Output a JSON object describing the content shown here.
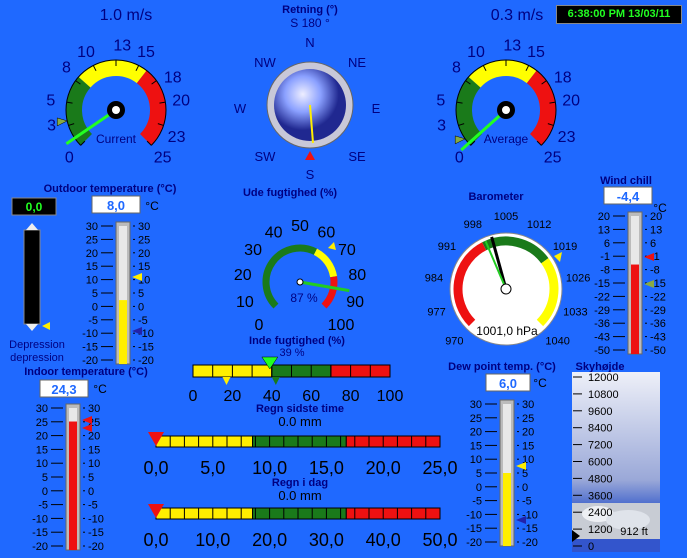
{
  "clock": "6:38:00 PM 13/03/11",
  "wind_current": {
    "speed": "1.0 m/s",
    "label": "Current",
    "ticks": [
      "0",
      "3",
      "5",
      "8",
      "10",
      "13",
      "15",
      "18",
      "20",
      "23",
      "25"
    ],
    "value": 1.0,
    "max": 25,
    "colors": {
      "low": "#1a7a1a",
      "mid": "#ffff00",
      "high": "#ee1111"
    }
  },
  "wind_average": {
    "speed": "0.3 m/s",
    "label": "Average",
    "ticks": [
      "0",
      "3",
      "5",
      "8",
      "10",
      "13",
      "15",
      "18",
      "20",
      "23",
      "25"
    ],
    "value": 0.3,
    "max": 25
  },
  "direction": {
    "title": "Retning (°)",
    "value": "S  180 °",
    "points": [
      "N",
      "NE",
      "E",
      "SE",
      "S",
      "SW",
      "W",
      "NW"
    ]
  },
  "outdoor": {
    "title": "Outdoor temperature (°C)",
    "value": "8,0",
    "unit": "°C",
    "ticks": [
      "30",
      "25",
      "20",
      "15",
      "10",
      "5",
      "0",
      "-5",
      "-10",
      "-15",
      "-20"
    ],
    "depression_value": "0,0",
    "depression_label": [
      "Depression",
      "depression"
    ]
  },
  "humidity_out": {
    "title": "Ude fugtighed (%)",
    "value": "87 %",
    "ticks": [
      "0",
      "10",
      "20",
      "30",
      "40",
      "50",
      "60",
      "70",
      "80",
      "90",
      "100"
    ]
  },
  "humidity_in": {
    "title": "Inde fugtighed (%)",
    "value": "39 %",
    "ticks": [
      "0",
      "20",
      "40",
      "60",
      "80",
      "100"
    ]
  },
  "barometer": {
    "title": "Barometer",
    "value": "1001,0 hPa",
    "ticks": [
      "970",
      "977",
      "984",
      "991",
      "998",
      "1005",
      "1012",
      "1019",
      "1026",
      "1033",
      "1040"
    ]
  },
  "wind_chill": {
    "title": "Wind chill",
    "value": "-4,4",
    "unit": "°C",
    "ticks": [
      "20",
      "13",
      "6",
      "-1",
      "-8",
      "-15",
      "-22",
      "-29",
      "-36",
      "-43",
      "-50"
    ]
  },
  "indoor": {
    "title": "Indoor temperature (°C)",
    "value": "24,3",
    "unit": "°C",
    "ticks": [
      "30",
      "25",
      "20",
      "15",
      "10",
      "5",
      "0",
      "-5",
      "-10",
      "-15",
      "-20"
    ]
  },
  "dewpoint": {
    "title": "Dew point temp. (°C)",
    "value": "6,0",
    "unit": "°C",
    "ticks": [
      "30",
      "25",
      "20",
      "15",
      "10",
      "5",
      "0",
      "-5",
      "-10",
      "-15",
      "-20"
    ]
  },
  "rain_last": {
    "title": "Regn sidste time",
    "value": "0.0 mm",
    "ticks": [
      "0,0",
      "5,0",
      "10,0",
      "15,0",
      "20,0",
      "25,0"
    ]
  },
  "rain_day": {
    "title": "Regn i dag",
    "value": "0.0 mm",
    "ticks": [
      "0,0",
      "10,0",
      "20,0",
      "30,0",
      "40,0",
      "50,0"
    ]
  },
  "cloud": {
    "title": "Skyhøjde",
    "value": "912 ft",
    "ticks": [
      "12000",
      "10800",
      "9600",
      "8400",
      "7200",
      "6000",
      "4800",
      "3600",
      "2400",
      "1200",
      "0"
    ]
  }
}
